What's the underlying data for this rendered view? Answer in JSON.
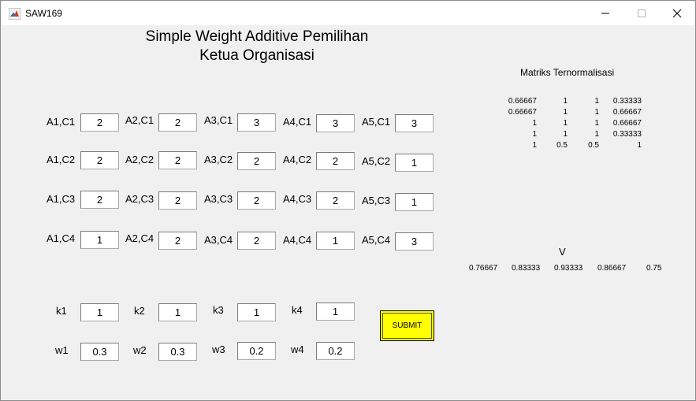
{
  "window": {
    "title": "SAW169"
  },
  "heading": {
    "line1": "Simple Weight Additive Pemilihan",
    "line2": "Ketua Organisasi"
  },
  "criteria": [
    {
      "row": 1,
      "cells": [
        {
          "label": "A1,C1",
          "value": "2"
        },
        {
          "label": "A2,C1",
          "value": "2"
        },
        {
          "label": "A3,C1",
          "value": "3"
        },
        {
          "label": "A4,C1",
          "value": "3"
        },
        {
          "label": "A5,C1",
          "value": "3"
        }
      ]
    },
    {
      "row": 2,
      "cells": [
        {
          "label": "A1,C2",
          "value": "2"
        },
        {
          "label": "A2,C2",
          "value": "2"
        },
        {
          "label": "A3,C2",
          "value": "2"
        },
        {
          "label": "A4,C2",
          "value": "2"
        },
        {
          "label": "A5,C2",
          "value": "1"
        }
      ]
    },
    {
      "row": 3,
      "cells": [
        {
          "label": "A1,C3",
          "value": "2"
        },
        {
          "label": "A2,C3",
          "value": "2"
        },
        {
          "label": "A3,C3",
          "value": "2"
        },
        {
          "label": "A4,C3",
          "value": "2"
        },
        {
          "label": "A5,C3",
          "value": "1"
        }
      ]
    },
    {
      "row": 4,
      "cells": [
        {
          "label": "A1,C4",
          "value": "1"
        },
        {
          "label": "A2,C4",
          "value": "2"
        },
        {
          "label": "A3,C4",
          "value": "2"
        },
        {
          "label": "A4,C4",
          "value": "1"
        },
        {
          "label": "A5,C4",
          "value": "3"
        }
      ]
    }
  ],
  "k": [
    {
      "label": "k1",
      "value": "1"
    },
    {
      "label": "k2",
      "value": "1"
    },
    {
      "label": "k3",
      "value": "1"
    },
    {
      "label": "k4",
      "value": "1"
    }
  ],
  "w": [
    {
      "label": "w1",
      "value": "0.3"
    },
    {
      "label": "w2",
      "value": "0.3"
    },
    {
      "label": "w3",
      "value": "0.2"
    },
    {
      "label": "w4",
      "value": "0.2"
    }
  ],
  "submit_label": "SUBMIT",
  "submit_color": "#ffff00",
  "matrix": {
    "title": "Matriks Ternormalisasi",
    "rows": [
      [
        "0.66667",
        "1",
        "1",
        "0.33333"
      ],
      [
        "0.66667",
        "1",
        "1",
        "0.66667"
      ],
      [
        "1",
        "1",
        "1",
        "0.66667"
      ],
      [
        "1",
        "1",
        "1",
        "0.33333"
      ],
      [
        "1",
        "0.5",
        "0.5",
        "1"
      ]
    ]
  },
  "v": {
    "title": "V",
    "values": [
      "0.76667",
      "0.83333",
      "0.93333",
      "0.86667",
      "0.75"
    ]
  }
}
